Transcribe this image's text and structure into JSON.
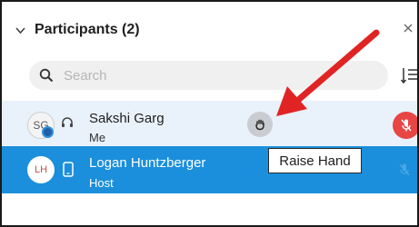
{
  "panel": {
    "title": "Participants (2)",
    "collapse_icon": "chevron-down-icon",
    "close_icon": "close-icon"
  },
  "search": {
    "placeholder": "Search",
    "icon": "search-icon",
    "sort_icon": "sort-icon"
  },
  "participants": [
    {
      "initials": "SG",
      "name": "Sakshi Garg",
      "role": "Me",
      "device_icon": "headset-icon",
      "presence_icon": "presence-status-icon",
      "raise_hand_icon": "raise-hand-icon",
      "mic_icon": "mic-muted-icon",
      "mic_color": "#e84545"
    },
    {
      "initials": "LH",
      "name": "Logan Huntzberger",
      "role": "Host",
      "device_icon": "phone-icon",
      "mic_icon": "mic-muted-icon"
    }
  ],
  "tooltip": {
    "text": "Raise Hand"
  },
  "annotation": {
    "arrow_color": "#e02424"
  },
  "colors": {
    "selected_row": "#1b8fdb",
    "hover_row": "#e9f1fa"
  }
}
